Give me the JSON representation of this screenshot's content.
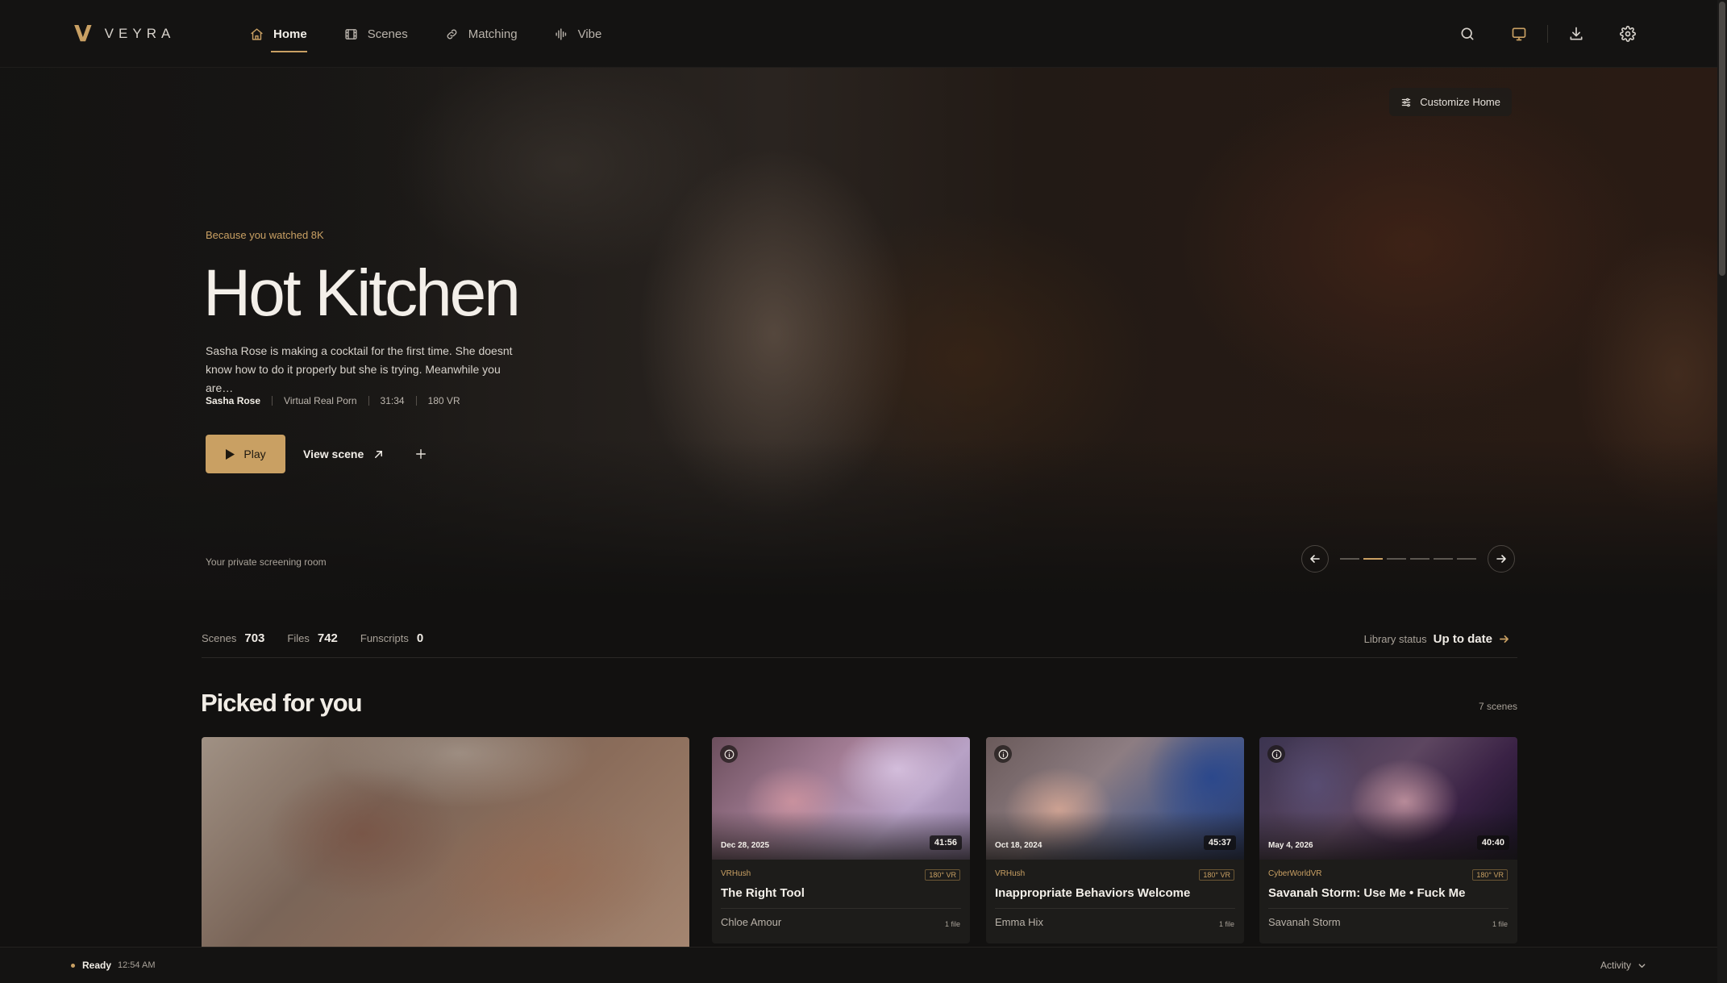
{
  "brand": {
    "mark": "V",
    "name": "VEYRA"
  },
  "nav": {
    "items": [
      {
        "label": "Home",
        "icon": "home-icon",
        "active": true
      },
      {
        "label": "Scenes",
        "icon": "film-icon",
        "active": false
      },
      {
        "label": "Matching",
        "icon": "link-icon",
        "active": false
      },
      {
        "label": "Vibe",
        "icon": "waveform-icon",
        "active": false
      }
    ],
    "right_icons": [
      "search-icon",
      "monitor-icon",
      "download-icon",
      "gear-icon"
    ]
  },
  "hero": {
    "customize_label": "Customize Home",
    "eyebrow": "Because you watched 8K",
    "title": "Hot Kitchen",
    "description": "Sasha Rose is making a cocktail for the first time. She doesnt know how to do it properly but she is trying. Meanwhile you are…",
    "meta": {
      "performer": "Sasha Rose",
      "studio": "Virtual Real Porn",
      "duration": "31:34",
      "format": "180 VR"
    },
    "play_label": "Play",
    "view_label": "View scene",
    "tagline": "Your private screening room",
    "carousel": {
      "count": 6,
      "active_index": 1
    }
  },
  "stats": {
    "scenes_label": "Scenes",
    "scenes_value": "703",
    "files_label": "Files",
    "files_value": "742",
    "funscripts_label": "Funscripts",
    "funscripts_value": "0",
    "library_label": "Library status",
    "library_value": "Up to date"
  },
  "picked": {
    "title": "Picked for you",
    "count": "7 scenes",
    "cards": [
      {
        "date": "Dec 28, 2025",
        "duration": "41:56",
        "studio": "VRHush",
        "badge": "180° VR",
        "title": "The Right Tool",
        "performer": "Chloe Amour",
        "files": "1 file"
      },
      {
        "date": "Oct 18, 2024",
        "duration": "45:37",
        "studio": "VRHush",
        "badge": "180° VR",
        "title": "Inappropriate Behaviors Welcome",
        "performer": "Emma Hix",
        "files": "1 file"
      },
      {
        "date": "May 4, 2026",
        "duration": "40:40",
        "studio": "CyberWorldVR",
        "badge": "180° VR",
        "title": "Savanah Storm: Use Me • Fuck Me",
        "performer": "Savanah Storm",
        "files": "1 file"
      }
    ]
  },
  "status": {
    "state": "Ready",
    "time": "12:54 AM",
    "activity_label": "Activity"
  },
  "colors": {
    "accent": "#c9a063",
    "background": "#121110",
    "surface": "#1d1c1a"
  }
}
